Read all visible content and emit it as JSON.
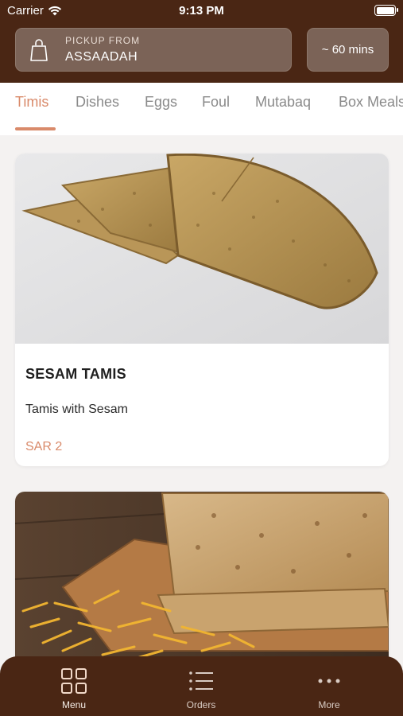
{
  "status_bar": {
    "carrier": "Carrier",
    "time": "9:13 PM"
  },
  "header": {
    "pickup_label": "PICKUP FROM",
    "pickup_location": "ASSAADAH",
    "eta": "~ 60 mins"
  },
  "category_tabs": [
    {
      "label": "Timis",
      "active": true
    },
    {
      "label": "Dishes",
      "active": false
    },
    {
      "label": "Eggs",
      "active": false
    },
    {
      "label": "Foul",
      "active": false
    },
    {
      "label": "Mutabaq",
      "active": false
    },
    {
      "label": "Box Meals",
      "active": false
    }
  ],
  "products": [
    {
      "title": "SESAM TAMIS",
      "description": "Tamis with Sesam",
      "price": "SAR 2"
    },
    {
      "title": "",
      "description": "",
      "price": ""
    }
  ],
  "bottom_nav": [
    {
      "label": "Menu",
      "icon": "grid-icon",
      "active": true
    },
    {
      "label": "Orders",
      "icon": "list-icon",
      "active": false
    },
    {
      "label": "More",
      "icon": "more-dots-icon",
      "active": false
    }
  ],
  "colors": {
    "brand_brown": "#4a2614",
    "accent": "#d98a6a",
    "pill_bg": "#7b6357"
  }
}
